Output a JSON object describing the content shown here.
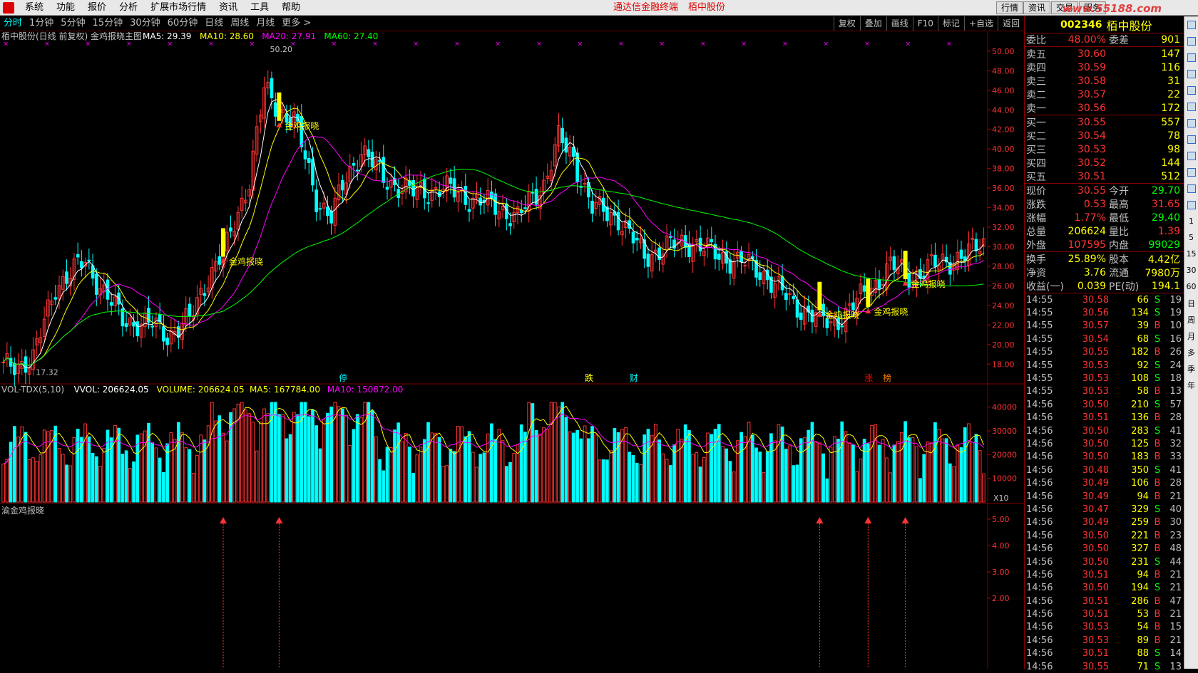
{
  "menu": {
    "items": [
      "系统",
      "功能",
      "报价",
      "分析",
      "扩展市场行情",
      "资讯",
      "工具",
      "帮助"
    ],
    "center_title": "通达信金融终端",
    "center_stock": "栢中股份",
    "right_buttons": [
      "行情",
      "资讯",
      "交易",
      "服务"
    ],
    "watermark": "www.55188.com"
  },
  "toolbar": {
    "periods": [
      "分时",
      "1分钟",
      "5分钟",
      "15分钟",
      "30分钟",
      "60分钟",
      "日线",
      "周线",
      "月线",
      "更多 >"
    ],
    "right": [
      "复权",
      "叠加",
      "画线",
      "F10",
      "标记",
      "+自选",
      "返回"
    ]
  },
  "main_chart": {
    "title": "栢中股份(日线 前复权) 金鸡报晓主图",
    "ma_labels": [
      {
        "t": "MA5: 29.39",
        "c": "#ffffff"
      },
      {
        "t": "MA10: 28.60",
        "c": "#ffff00"
      },
      {
        "t": "MA20: 27.91",
        "c": "#ff00ff"
      },
      {
        "t": "MA60: 27.40",
        "c": "#00ff00"
      }
    ],
    "y_ticks": [
      "50.00",
      "48.00",
      "46.00",
      "44.00",
      "42.00",
      "40.00",
      "38.00",
      "36.00",
      "34.00",
      "32.00",
      "30.00",
      "28.00",
      "26.00",
      "24.00",
      "22.00",
      "20.00",
      "18.00"
    ],
    "high_label": "50.20",
    "low_label": "17.32",
    "signal_label": "金鸡报晓",
    "event_tags": [
      {
        "t": "停",
        "c": "#00ffff"
      },
      {
        "t": "跌",
        "c": "#ffff00"
      },
      {
        "t": "财",
        "c": "#00ffff"
      },
      {
        "t": "涨",
        "c": "#ff0000"
      },
      {
        "t": "榜",
        "c": "#ff8000"
      }
    ]
  },
  "volume_chart": {
    "labels": [
      {
        "t": "VOL-TDX(5,10)",
        "c": "#c0c0c0"
      },
      {
        "t": "VVOL: 206624.05",
        "c": "#ffffff"
      },
      {
        "t": "VOLUME: 206624.05",
        "c": "#ffff00"
      },
      {
        "t": "MA5: 167784.00",
        "c": "#ffff00"
      },
      {
        "t": "MA10: 150872.00",
        "c": "#ff00ff"
      }
    ],
    "y_ticks": [
      "40000",
      "30000",
      "20000",
      "10000"
    ],
    "unit": "X10"
  },
  "indicator_chart": {
    "label": "渝金鸡报晓",
    "y_ticks": [
      "5.00",
      "4.00",
      "3.00",
      "2.00"
    ]
  },
  "quote": {
    "code": "002346",
    "name": "栢中股份",
    "weibi": {
      "l1": "委比",
      "v1": "48.00%",
      "l2": "委差",
      "v2": "901"
    },
    "asks": [
      {
        "l": "卖五",
        "p": "30.60",
        "v": "147"
      },
      {
        "l": "卖四",
        "p": "30.59",
        "v": "116"
      },
      {
        "l": "卖三",
        "p": "30.58",
        "v": "31"
      },
      {
        "l": "卖二",
        "p": "30.57",
        "v": "22"
      },
      {
        "l": "卖一",
        "p": "30.56",
        "v": "172"
      }
    ],
    "bids": [
      {
        "l": "买一",
        "p": "30.55",
        "v": "557"
      },
      {
        "l": "买二",
        "p": "30.54",
        "v": "78"
      },
      {
        "l": "买三",
        "p": "30.53",
        "v": "98"
      },
      {
        "l": "买四",
        "p": "30.52",
        "v": "144"
      },
      {
        "l": "买五",
        "p": "30.51",
        "v": "512"
      }
    ],
    "stats1": [
      {
        "l1": "现价",
        "v1": "30.55",
        "c1": "#ff3333",
        "l2": "今开",
        "v2": "29.70",
        "c2": "#00ff00"
      },
      {
        "l1": "涨跌",
        "v1": "0.53",
        "c1": "#ff3333",
        "l2": "最高",
        "v2": "31.65",
        "c2": "#ff3333"
      },
      {
        "l1": "涨幅",
        "v1": "1.77%",
        "c1": "#ff3333",
        "l2": "最低",
        "v2": "29.40",
        "c2": "#00ff00"
      },
      {
        "l1": "总量",
        "v1": "206624",
        "c1": "#ffff00",
        "l2": "量比",
        "v2": "1.39",
        "c2": "#ff3333"
      },
      {
        "l1": "外盘",
        "v1": "107595",
        "c1": "#ff3333",
        "l2": "内盘",
        "v2": "99029",
        "c2": "#00ff00"
      }
    ],
    "stats2": [
      {
        "l1": "换手",
        "v1": "25.89%",
        "c1": "#ffff00",
        "l2": "股本",
        "v2": "4.42亿",
        "c2": "#ffff00"
      },
      {
        "l1": "净资",
        "v1": "3.76",
        "c1": "#ffff00",
        "l2": "流通",
        "v2": "7980万",
        "c2": "#ffff00"
      },
      {
        "l1": "收益(一)",
        "v1": "0.039",
        "c1": "#ffff00",
        "l2": "PE(动)",
        "v2": "194.1",
        "c2": "#ffff00"
      }
    ],
    "ticks": [
      [
        "14:55",
        "30.58",
        "66",
        "S",
        "19"
      ],
      [
        "14:55",
        "30.56",
        "134",
        "S",
        "19"
      ],
      [
        "14:55",
        "30.57",
        "39",
        "B",
        "10"
      ],
      [
        "14:55",
        "30.54",
        "68",
        "S",
        "16"
      ],
      [
        "14:55",
        "30.55",
        "182",
        "B",
        "26"
      ],
      [
        "14:55",
        "30.53",
        "92",
        "S",
        "24"
      ],
      [
        "14:55",
        "30.53",
        "108",
        "S",
        "18"
      ],
      [
        "14:55",
        "30.53",
        "58",
        "B",
        "13"
      ],
      [
        "14:56",
        "30.50",
        "210",
        "S",
        "57"
      ],
      [
        "14:56",
        "30.51",
        "136",
        "B",
        "28"
      ],
      [
        "14:56",
        "30.50",
        "283",
        "S",
        "41"
      ],
      [
        "14:56",
        "30.50",
        "125",
        "B",
        "32"
      ],
      [
        "14:56",
        "30.50",
        "183",
        "B",
        "33"
      ],
      [
        "14:56",
        "30.48",
        "350",
        "S",
        "41"
      ],
      [
        "14:56",
        "30.49",
        "106",
        "B",
        "28"
      ],
      [
        "14:56",
        "30.49",
        "94",
        "B",
        "21"
      ],
      [
        "14:56",
        "30.47",
        "329",
        "S",
        "40"
      ],
      [
        "14:56",
        "30.49",
        "259",
        "B",
        "30"
      ],
      [
        "14:56",
        "30.50",
        "221",
        "B",
        "23"
      ],
      [
        "14:56",
        "30.50",
        "327",
        "B",
        "48"
      ],
      [
        "14:56",
        "30.50",
        "231",
        "S",
        "44"
      ],
      [
        "14:56",
        "30.51",
        "94",
        "B",
        "21"
      ],
      [
        "14:56",
        "30.50",
        "194",
        "S",
        "21"
      ],
      [
        "14:56",
        "30.51",
        "286",
        "B",
        "47"
      ],
      [
        "14:56",
        "30.51",
        "53",
        "B",
        "21"
      ],
      [
        "14:56",
        "30.53",
        "54",
        "B",
        "15"
      ],
      [
        "14:56",
        "30.53",
        "89",
        "B",
        "21"
      ],
      [
        "14:56",
        "30.51",
        "88",
        "S",
        "14"
      ],
      [
        "14:56",
        "30.55",
        "71",
        "S",
        "13"
      ]
    ]
  },
  "sidebar": {
    "labels": [
      "1",
      "5",
      "15",
      "30",
      "60",
      "日",
      "周",
      "月",
      "多",
      "季",
      "年"
    ]
  },
  "colors": {
    "up": "#ff3333",
    "down": "#00ffff",
    "ma5": "#ffffff",
    "ma10": "#ffff00",
    "ma20": "#ff00ff",
    "ma60": "#00ff00",
    "signal": "#ffff00",
    "grid": "#800000"
  }
}
